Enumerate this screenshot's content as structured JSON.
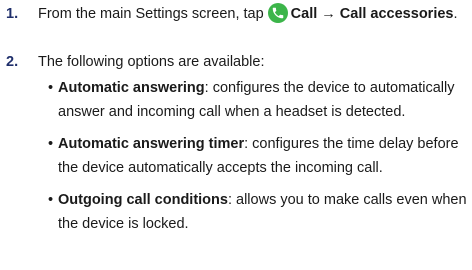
{
  "steps": [
    {
      "number": "1.",
      "pre": "From the main Settings screen, tap",
      "icon": "phone-call-icon",
      "bold": "Call → Call accessories",
      "post": "."
    },
    {
      "number": "2.",
      "text": "The following options are available:"
    }
  ],
  "options": [
    {
      "name": "Automatic answering",
      "description": ": configures the device to automatically answer and incoming call when a headset is detected."
    },
    {
      "name": "Automatic answering timer",
      "description": ": configures the time delay before the device automatically accepts the incoming call."
    },
    {
      "name": "Outgoing call conditions",
      "description": ": allows you to make calls even when the device is locked."
    }
  ],
  "colors": {
    "number": "#1f2f6b",
    "icon_bg": "#3cb54a"
  }
}
